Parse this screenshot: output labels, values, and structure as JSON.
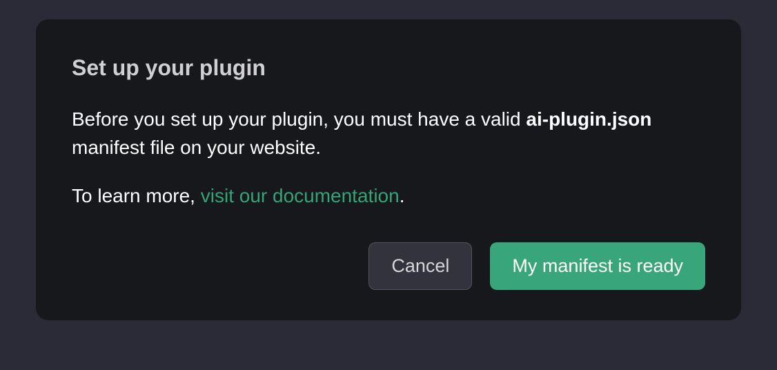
{
  "dialog": {
    "title": "Set up your plugin",
    "body": {
      "intro_prefix": "Before you set up your plugin, you must have a valid ",
      "manifest_filename": "ai-plugin.json",
      "intro_suffix": " manifest file on your website.",
      "learn_prefix": "To learn more, ",
      "doc_link_text": "visit our documentation",
      "learn_suffix": "."
    },
    "buttons": {
      "cancel": "Cancel",
      "confirm": "My manifest is ready"
    }
  }
}
